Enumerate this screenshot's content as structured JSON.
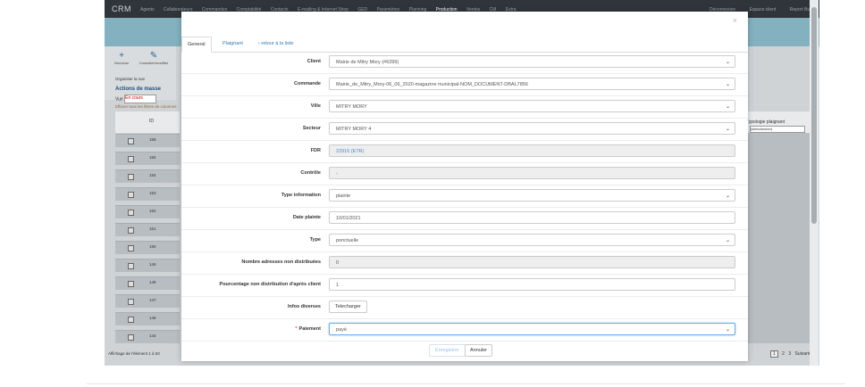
{
  "topnav": {
    "brand": "CRM",
    "menu": [
      "Agents",
      "Collaborateurs",
      "Commandes",
      "Comptabilité",
      "Contacts",
      "E-mailing & Internet Shop",
      "GED",
      "Paramètres",
      "Planning",
      "Production",
      "Ventes",
      "CM",
      "Extra"
    ],
    "active_index": 9,
    "right": [
      "Déconnexion",
      "Espace client",
      "Report Bug"
    ]
  },
  "background": {
    "tool_new": "Nouveau",
    "tool_consult": "Consulter/modifier",
    "organise": "Organiser la vue",
    "actions_title": "Actions de masse",
    "vue_label": "Vue",
    "vue_value": "En cours",
    "filter_link": "Effacer tous les filtres de colonnes",
    "id_header": "ID",
    "rows": [
      "156",
      "155",
      "154",
      "153",
      "152",
      "151",
      "150",
      "149",
      "148",
      "147",
      "146",
      "144"
    ],
    "right_header": "Typologie plaignant",
    "right_select": "(sélectionner)",
    "footer_info": "Affichage de l'élément 1 à 50",
    "pages": [
      "1",
      "2",
      "3"
    ],
    "next": "Suivant"
  },
  "modal": {
    "close": "×",
    "tabs": [
      "General",
      "Plaignant"
    ],
    "back_link": "retour à la liste",
    "fields": [
      {
        "label": "Client",
        "value": "Mairie de Mitry Mory (#6399)",
        "kind": "select"
      },
      {
        "label": "Commande",
        "value": "Mairie_de_Mitry_Mory-06_06_2020-magazine municipal-NOM_DOCUMENT-DBAL7856",
        "kind": "select"
      },
      {
        "label": "Ville",
        "value": "MITRY MORY",
        "kind": "select"
      },
      {
        "label": "Secteur",
        "value": "MITRY MORY 4",
        "kind": "select"
      },
      {
        "label": "FDR",
        "value": "22916 (ETR)",
        "kind": "readonly-link"
      },
      {
        "label": "Contrôle",
        "value": "-",
        "kind": "readonly"
      },
      {
        "label": "Type information",
        "value": "plainte",
        "kind": "select"
      },
      {
        "label": "Date plainte",
        "value": "10/01/2021",
        "kind": "text"
      },
      {
        "label": "Type",
        "value": "ponctuelle",
        "kind": "select"
      },
      {
        "label": "Nombre adresses non distribuées",
        "value": "0",
        "kind": "readonly"
      },
      {
        "label": "Pourcentage non distribution d'après client",
        "value": "1",
        "kind": "text"
      },
      {
        "label": "Infos diverses",
        "value": "Telecharger",
        "kind": "button"
      },
      {
        "label": "Paiement",
        "value": "payé",
        "kind": "select-focus",
        "required": "*"
      }
    ],
    "save": "Enregistrer",
    "cancel": "Annuler"
  },
  "colors": {
    "accent": "#337ab7",
    "header": "#2f353a",
    "band": "#83b1bf",
    "required": "#cc0000"
  },
  "icons": {
    "new": "plus-icon",
    "consult": "pencil-icon",
    "back": "chevron-left-icon",
    "dropdown": "chevron-down-icon"
  }
}
